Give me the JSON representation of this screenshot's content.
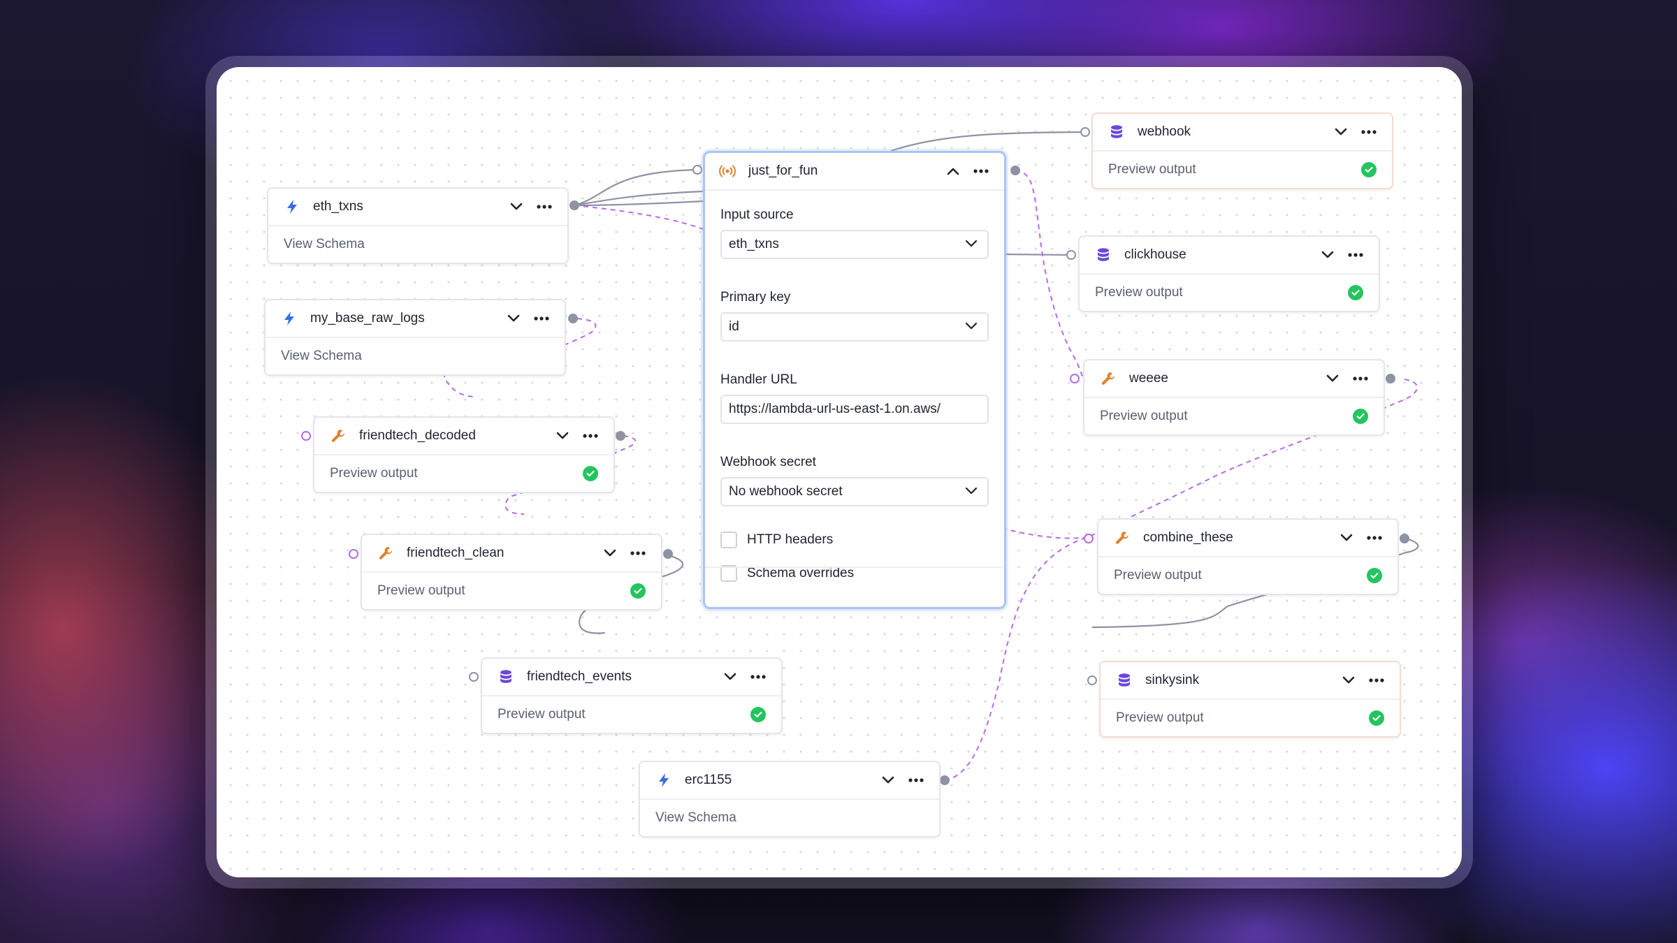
{
  "colors": {
    "accent_selected": "#a9c4f5",
    "solid_edge": "#8e93a3",
    "dashed_edge": "#b56be8",
    "source_icon": "#3b6fe0",
    "transform_icon": "#e0822e",
    "sink_icon": "#6a48d8",
    "check_ok": "#22c55e"
  },
  "nodes": {
    "eth_txns": {
      "title": "eth_txns",
      "body": "View Schema",
      "icon": "lightning-icon"
    },
    "my_base_raw_logs": {
      "title": "my_base_raw_logs",
      "body": "View Schema",
      "icon": "lightning-icon"
    },
    "friendtech_decoded": {
      "title": "friendtech_decoded",
      "body": "Preview output",
      "icon": "wrench-icon"
    },
    "friendtech_clean": {
      "title": "friendtech_clean",
      "body": "Preview output",
      "icon": "wrench-icon"
    },
    "friendtech_events": {
      "title": "friendtech_events",
      "body": "Preview output",
      "icon": "database-icon"
    },
    "erc1155": {
      "title": "erc1155",
      "body": "View Schema",
      "icon": "lightning-icon"
    },
    "webhook": {
      "title": "webhook",
      "body": "Preview output",
      "icon": "database-icon"
    },
    "clickhouse": {
      "title": "clickhouse",
      "body": "Preview output",
      "icon": "database-icon"
    },
    "weeee": {
      "title": "weeee",
      "body": "Preview output",
      "icon": "wrench-icon"
    },
    "combine_these": {
      "title": "combine_these",
      "body": "Preview output",
      "icon": "wrench-icon"
    },
    "sinkysink": {
      "title": "sinkysink",
      "body": "Preview output",
      "icon": "database-icon"
    }
  },
  "main_node": {
    "title": "just_for_fun",
    "icon": "broadcast-icon",
    "input_source": {
      "label": "Input source",
      "value": "eth_txns"
    },
    "primary_key": {
      "label": "Primary key",
      "value": "id"
    },
    "handler_url": {
      "label": "Handler URL",
      "value": "https://lambda-url-us-east-1.on.aws/"
    },
    "webhook_secret": {
      "label": "Webhook secret",
      "value": "No webhook secret"
    },
    "http_headers": {
      "label": "HTTP headers",
      "checked": false
    },
    "schema_overrides": {
      "label": "Schema overrides",
      "checked": false
    }
  }
}
